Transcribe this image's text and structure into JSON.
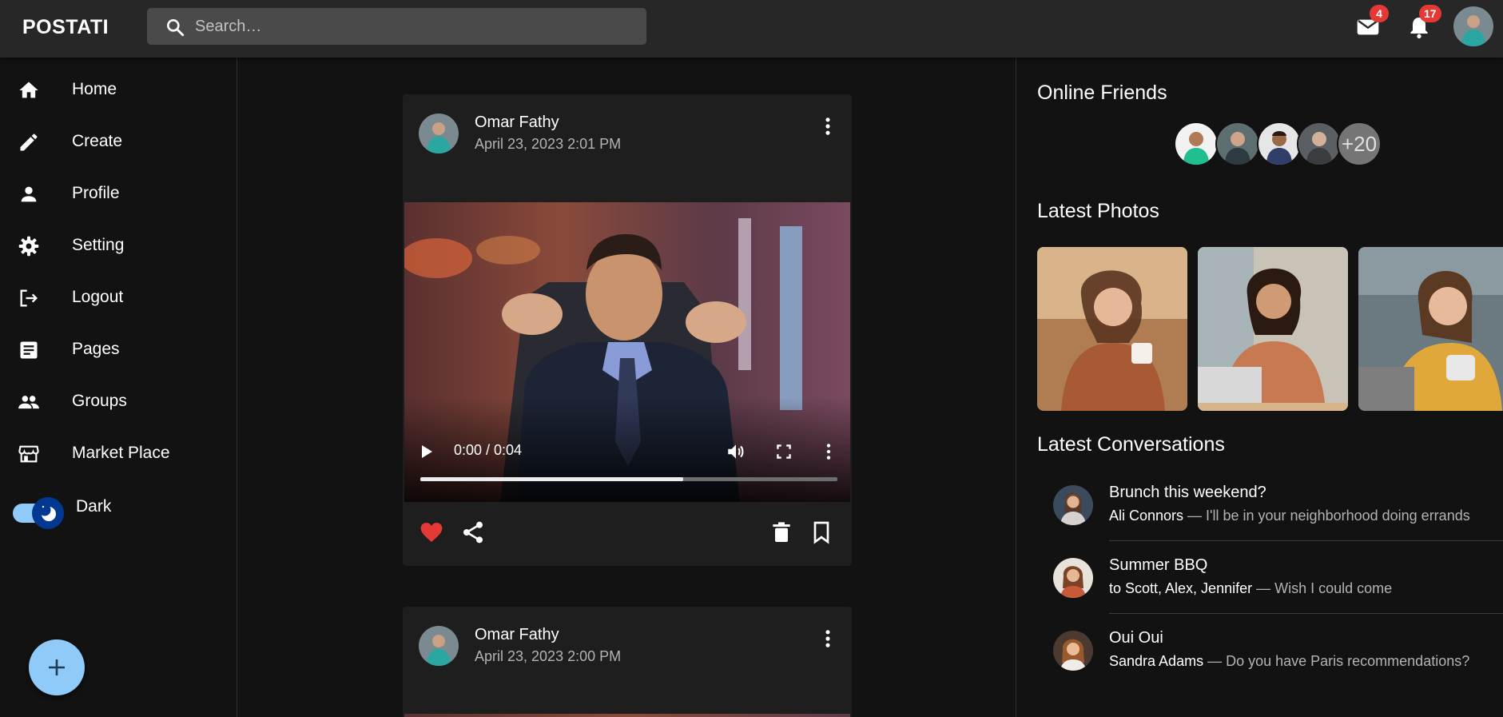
{
  "app": {
    "brand": "POSTATI"
  },
  "search": {
    "placeholder": "Search…"
  },
  "header": {
    "mail_badge": "4",
    "notif_badge": "17"
  },
  "sidebar": {
    "items": [
      {
        "label": "Home",
        "icon": "home-icon"
      },
      {
        "label": "Create",
        "icon": "pencil-icon"
      },
      {
        "label": "Profile",
        "icon": "person-icon"
      },
      {
        "label": "Setting",
        "icon": "gear-icon"
      },
      {
        "label": "Logout",
        "icon": "logout-icon"
      },
      {
        "label": "Pages",
        "icon": "article-icon"
      },
      {
        "label": "Groups",
        "icon": "group-icon"
      },
      {
        "label": "Market Place",
        "icon": "storefront-icon"
      }
    ],
    "dark_mode_label": "Dark",
    "dark_mode_on": true
  },
  "feed": {
    "posts": [
      {
        "author": "Omar Fathy",
        "date": "April 23, 2023 2:01 PM",
        "video_time": "0:00 / 0:04",
        "progress": 0.63,
        "liked": true
      },
      {
        "author": "Omar Fathy",
        "date": "April 23, 2023 2:00 PM"
      }
    ]
  },
  "right": {
    "online_title": "Online Friends",
    "online_more": "+20",
    "photos_title": "Latest Photos",
    "conversations_title": "Latest Conversations",
    "conversations": [
      {
        "title": "Brunch this weekend?",
        "who": "Ali Connors",
        "text": " — I'll be in your neighborhood doing errands"
      },
      {
        "title": "Summer BBQ",
        "who": "to Scott, Alex, Jennifer",
        "text": " — Wish I could come"
      },
      {
        "title": "Oui Oui",
        "who": "Sandra Adams",
        "text": " — Do you have Paris recommendations?"
      }
    ]
  },
  "colors": {
    "background": "#121212",
    "topbar": "#272727",
    "card": "#1e1e1e",
    "accent": "#90caf9",
    "badge": "#e53935",
    "like": "#e53935"
  }
}
